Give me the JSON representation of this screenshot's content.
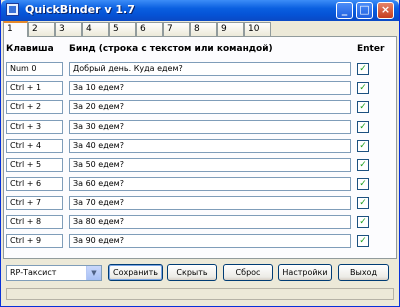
{
  "window": {
    "title": "QuickBinder v 1.7"
  },
  "tabs": [
    "1",
    "2",
    "3",
    "4",
    "5",
    "6",
    "7",
    "8",
    "9",
    "10"
  ],
  "headers": {
    "key": "Клавиша",
    "bind": "Бинд (строка с текстом или командой)",
    "enter": "Enter"
  },
  "rows": [
    {
      "key": "Num 0",
      "text": "Добрый день. Куда едем?",
      "enter": true
    },
    {
      "key": "Ctrl + 1",
      "text": "За 10 едем?",
      "enter": true
    },
    {
      "key": "Ctrl + 2",
      "text": "За 20 едем?",
      "enter": true
    },
    {
      "key": "Ctrl + 3",
      "text": "За 30 едем?",
      "enter": true
    },
    {
      "key": "Ctrl + 4",
      "text": "За 40 едем?",
      "enter": true
    },
    {
      "key": "Ctrl + 5",
      "text": "За 50 едем?",
      "enter": true
    },
    {
      "key": "Ctrl + 6",
      "text": "За 60 едем?",
      "enter": true
    },
    {
      "key": "Ctrl + 7",
      "text": "За 70 едем?",
      "enter": true
    },
    {
      "key": "Ctrl + 8",
      "text": "За 80 едем?",
      "enter": true
    },
    {
      "key": "Ctrl + 9",
      "text": "За 90 едем?",
      "enter": true
    }
  ],
  "profile": {
    "selected": "RP-Таксист"
  },
  "buttons": {
    "save": "Сохранить",
    "hide": "Скрыть",
    "reset": "Сброс",
    "settings": "Настройки",
    "exit": "Выход"
  },
  "colors": {
    "titlebar": "#0a5fe0",
    "check": "#21a121",
    "active_tab_accent": "#e68b2c"
  }
}
